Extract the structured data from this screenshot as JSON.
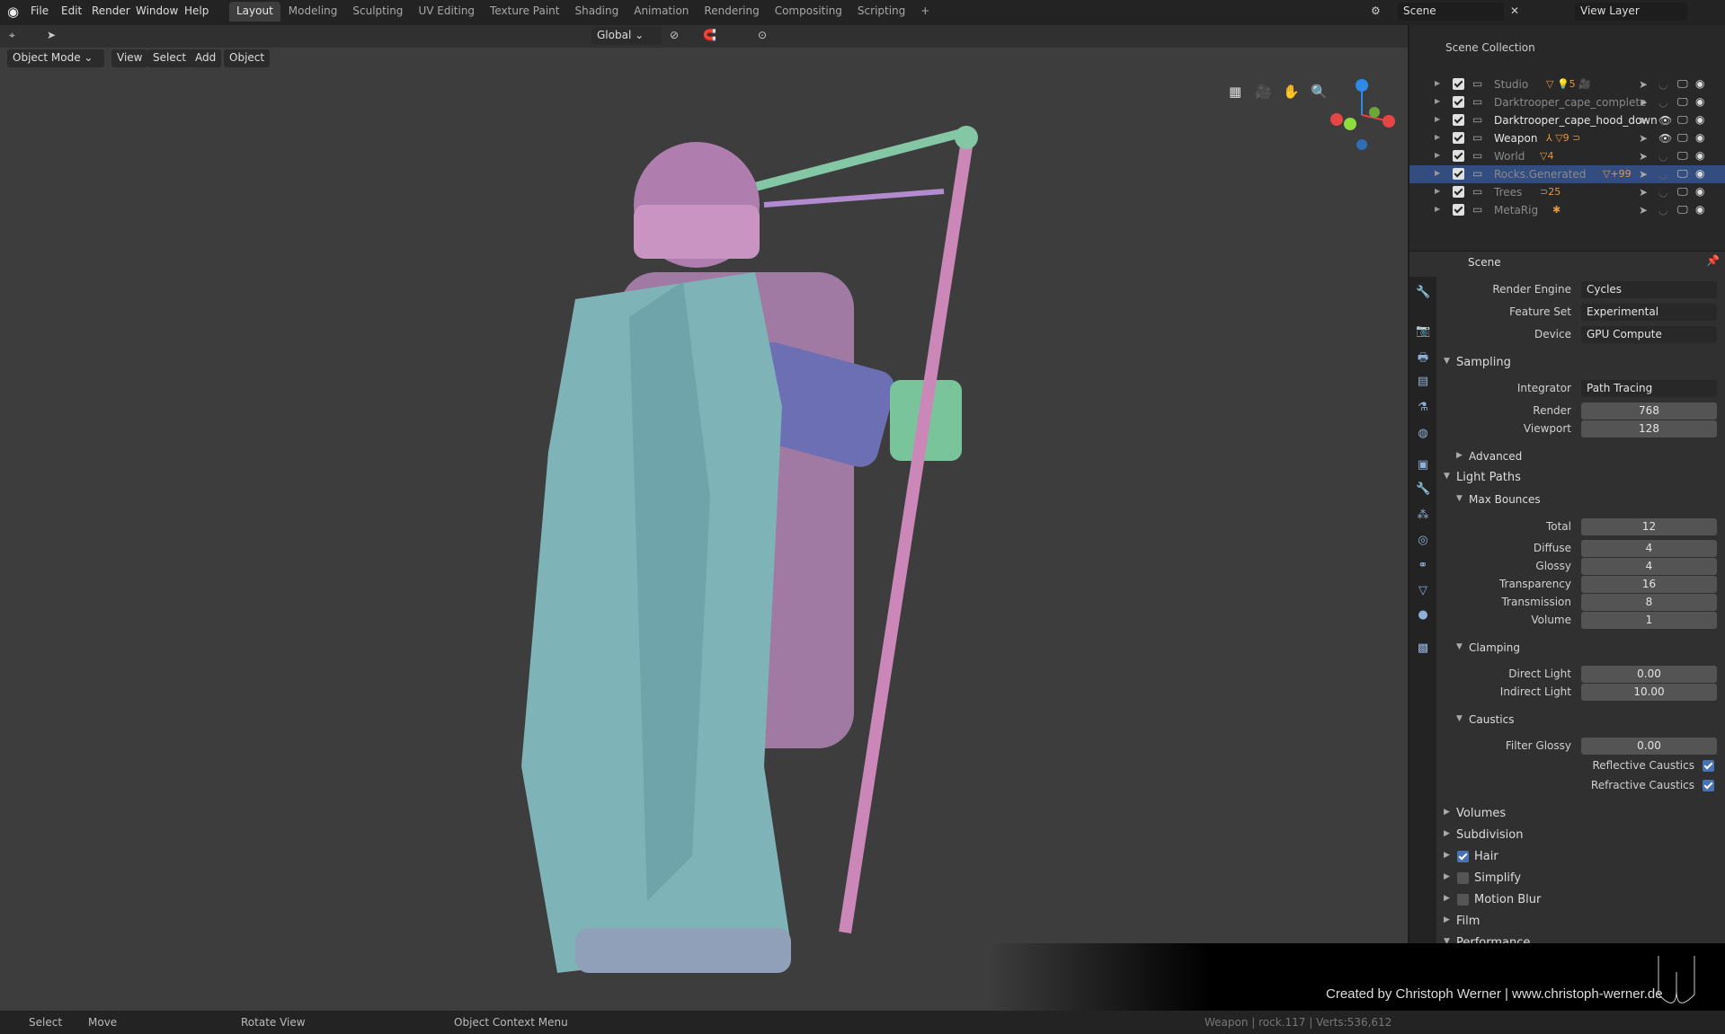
{
  "menu": [
    "File",
    "Edit",
    "Render",
    "Window",
    "Help"
  ],
  "workspaces": [
    "Layout",
    "Modeling",
    "Sculpting",
    "UV Editing",
    "Texture Paint",
    "Shading",
    "Animation",
    "Rendering",
    "Compositing",
    "Scripting",
    "+"
  ],
  "scene_name": "Scene",
  "view_layer": "View Layer",
  "transform": {
    "orientation": "Global"
  },
  "viewport_header": {
    "mode": "Object Mode",
    "menus": [
      "View",
      "Select",
      "Add",
      "Object"
    ]
  },
  "outliner": {
    "root": "Scene Collection",
    "rows": [
      {
        "name": "Studio",
        "dim": true,
        "badges": "▽ 💡5 🎥"
      },
      {
        "name": "Darktrooper_cape_complete",
        "dim": true,
        "badges": ""
      },
      {
        "name": "Darktrooper_cape_hood_down",
        "dim": false,
        "badges": ""
      },
      {
        "name": "Weapon",
        "dim": false,
        "badges": "⅄ ▽9 ⊃"
      },
      {
        "name": "World",
        "dim": true,
        "badges": "▽4"
      },
      {
        "name": "Rocks.Generated",
        "dim": true,
        "selected": true,
        "badges": "▽+99"
      },
      {
        "name": "Trees",
        "dim": true,
        "badges": "⊃25"
      },
      {
        "name": "MetaRig",
        "dim": true,
        "badges": "✱"
      }
    ]
  },
  "properties": {
    "context": "Scene",
    "render_engine": {
      "label": "Render Engine",
      "value": "Cycles"
    },
    "feature_set": {
      "label": "Feature Set",
      "value": "Experimental"
    },
    "device": {
      "label": "Device",
      "value": "GPU Compute"
    },
    "sampling": {
      "title": "Sampling",
      "integrator_label": "Integrator",
      "integrator": "Path Tracing",
      "render_label": "Render",
      "render": "768",
      "viewport_label": "Viewport",
      "viewport": "128",
      "advanced": "Advanced"
    },
    "light_paths": {
      "title": "Light Paths",
      "max_bounces": "Max Bounces",
      "bounces": [
        {
          "label": "Total",
          "value": "12"
        },
        {
          "label": "Diffuse",
          "value": "4"
        },
        {
          "label": "Glossy",
          "value": "4"
        },
        {
          "label": "Transparency",
          "value": "16"
        },
        {
          "label": "Transmission",
          "value": "8"
        },
        {
          "label": "Volume",
          "value": "1"
        }
      ],
      "clamping": "Clamping",
      "direct_label": "Direct Light",
      "direct": "0.00",
      "indirect_label": "Indirect Light",
      "indirect": "10.00",
      "caustics": "Caustics",
      "filter_glossy_label": "Filter Glossy",
      "filter_glossy": "0.00",
      "reflective": "Reflective Caustics",
      "reflective_on": true,
      "refractive": "Refractive Caustics",
      "refractive_on": true
    },
    "panels": [
      {
        "label": "Volumes"
      },
      {
        "label": "Subdivision"
      },
      {
        "label": "Hair",
        "checkbox": true,
        "checked": true
      },
      {
        "label": "Simplify",
        "checkbox": true,
        "checked": false
      },
      {
        "label": "Motion Blur",
        "checkbox": true,
        "checked": false
      },
      {
        "label": "Film"
      },
      {
        "label": "Performance"
      }
    ]
  },
  "status": {
    "select": "Select",
    "move": "Move",
    "rotate": "Rotate View",
    "context_menu": "Object Context Menu",
    "info": "Weapon | rock.117 | Verts:536,612"
  },
  "watermark": "Created by Christoph Werner | www.christoph-werner.de",
  "colors": {
    "selection": "#334d80",
    "accent": "#4772b3",
    "icon_orange": "#e8953e"
  }
}
